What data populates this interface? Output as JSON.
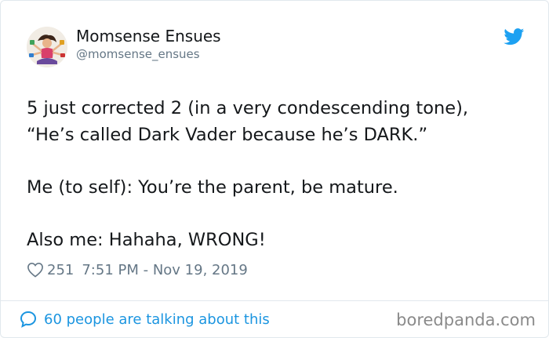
{
  "tweet": {
    "author": {
      "display_name": "Momsense Ensues",
      "handle": "@momsense_ensues",
      "avatar_icon": "avatar-illustration"
    },
    "brand_icon": "twitter-bird-icon",
    "text_lines": [
      "5 just corrected 2 (in a very condescending tone),",
      "“He’s called Dark Vader because he’s DARK.”",
      "Me (to self): You’re the parent, be mature.",
      "Also me: Hahaha, WRONG!"
    ],
    "likes": "251",
    "timestamp": "7:51 PM - Nov 19, 2019",
    "conversation_text": "60 people are talking about this"
  },
  "watermark": "boredpanda.com",
  "colors": {
    "text": "#14171a",
    "muted": "#657786",
    "link": "#1b95e0",
    "twitter_blue": "#1da1f2",
    "border": "#e1e8ed"
  }
}
